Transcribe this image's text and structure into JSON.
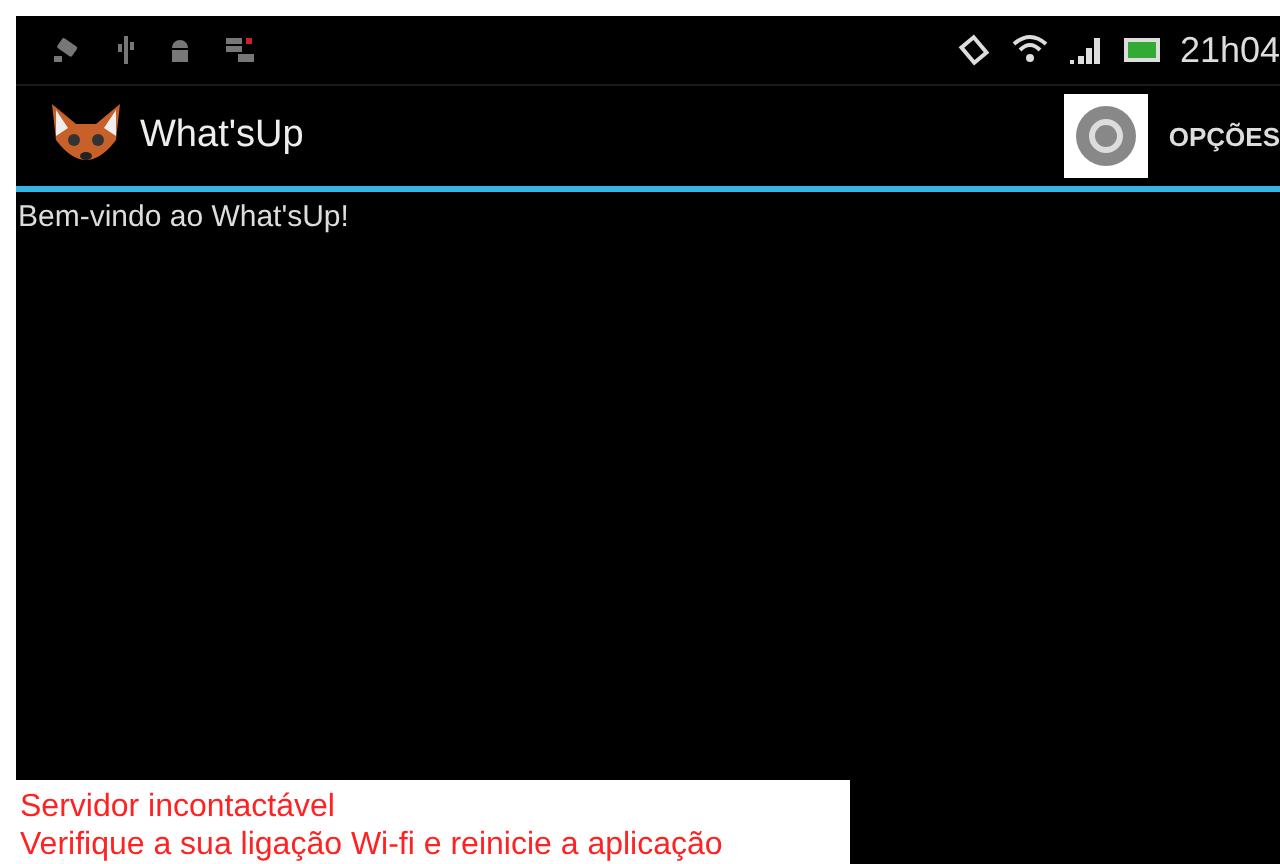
{
  "status_bar": {
    "time": "21h04"
  },
  "action_bar": {
    "title": "What'sUp",
    "menu_label": "OPÇÕES"
  },
  "content": {
    "welcome": "Bem-vindo ao What'sUp!"
  },
  "toast": {
    "lines": [
      "Servidor incontactável",
      "Verifique a sua ligação Wi-fi e reinicie a aplicação"
    ]
  }
}
